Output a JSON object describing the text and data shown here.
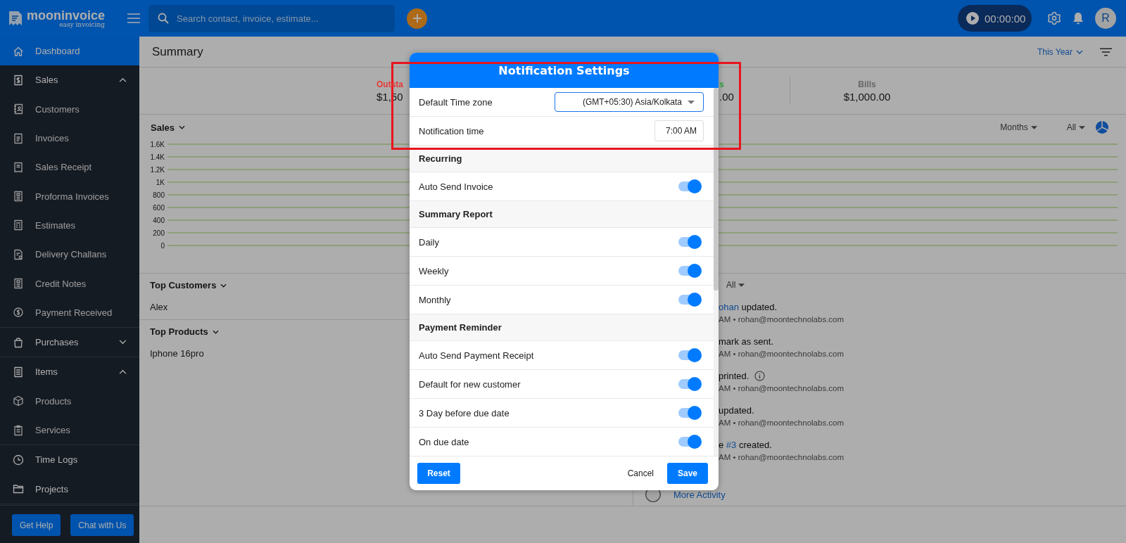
{
  "topbar": {
    "logo_name": "mooninvoice",
    "logo_tagline": "easy invoicing",
    "search": {
      "placeholder": "Search contact, invoice, estimate..."
    },
    "timer": "00:00:00",
    "avatar": "R"
  },
  "sidebar": {
    "items": [
      {
        "label": "Dashboard",
        "selected": true
      },
      {
        "label": "Sales",
        "selected": false,
        "expanded": true,
        "children": [
          {
            "label": "Customers",
            "selected": false
          },
          {
            "label": "Invoices",
            "selected": false
          },
          {
            "label": "Sales Receipt",
            "selected": false
          },
          {
            "label": "Proforma Invoices",
            "selected": false
          },
          {
            "label": "Estimates",
            "selected": false
          },
          {
            "label": "Delivery Challans",
            "selected": false
          },
          {
            "label": "Credit Notes",
            "selected": false
          },
          {
            "label": "Payment Received",
            "selected": false
          }
        ]
      },
      {
        "label": "Purchases",
        "selected": false,
        "expanded": false
      },
      {
        "label": "Items",
        "selected": false,
        "expanded": true,
        "children": [
          {
            "label": "Products",
            "selected": false
          },
          {
            "label": "Services",
            "selected": false
          }
        ]
      },
      {
        "label": "Time Logs",
        "selected": false
      },
      {
        "label": "Projects",
        "selected": false
      }
    ],
    "buttons": [
      "Get Help",
      "Chat with Us"
    ]
  },
  "main": {
    "title": "Summary",
    "period": "This Year",
    "stats": [
      {
        "label": "Outsta",
        "amount": "$1,50",
        "color": "#e53935"
      },
      {
        "label": "s",
        "amount": ".00",
        "color": "#2e9d3c"
      },
      {
        "label": "Bills",
        "amount": "$1,000.00",
        "color": "#666666"
      }
    ],
    "sales": {
      "title": "Sales",
      "grouping": "Months",
      "filter": "All",
      "axis_labels": [
        "1.6K",
        "1.4K",
        "1.2K",
        "1K",
        "800",
        "600",
        "400",
        "200",
        "0"
      ]
    },
    "top_customers": {
      "title": "Top Customers",
      "rows": [
        "Alex"
      ]
    },
    "top_products": {
      "title": "Top Products",
      "rows": [
        "Iphone 16pro"
      ]
    },
    "activity": {
      "filter": "All",
      "entries": [
        {
          "segments": [
            {
              "kind": "link",
              "text": "ohan"
            },
            {
              "kind": "text",
              "text": " updated."
            }
          ],
          "meta": "AM • rohan@moontechnolabs.com",
          "info": false
        },
        {
          "segments": [
            {
              "kind": "text",
              "text": "mark as sent."
            }
          ],
          "meta": "AM • rohan@moontechnolabs.com",
          "info": false
        },
        {
          "segments": [
            {
              "kind": "text",
              "text": "printed."
            }
          ],
          "meta": "AM • rohan@moontechnolabs.com",
          "info": true
        },
        {
          "segments": [
            {
              "kind": "text",
              "text": "updated."
            }
          ],
          "meta": "AM • rohan@moontechnolabs.com",
          "info": false
        },
        {
          "segments": [
            {
              "kind": "text",
              "text": "e "
            },
            {
              "kind": "link",
              "text": "#3"
            },
            {
              "kind": "text",
              "text": " created."
            }
          ],
          "meta": "AM • rohan@moontechnolabs.com",
          "info": false
        }
      ],
      "more": "More Activity"
    }
  },
  "dialog": {
    "title": "Notification Settings",
    "rows": [
      {
        "kind": "select",
        "label": "Default Time zone",
        "value": "(GMT+05:30) Asia/Kolkata"
      },
      {
        "kind": "time",
        "label": "Notification time",
        "value": "7:00 AM"
      },
      {
        "kind": "section",
        "label": "Recurring"
      },
      {
        "kind": "toggle",
        "label": "Auto Send Invoice",
        "on": true
      },
      {
        "kind": "section",
        "label": "Summary Report"
      },
      {
        "kind": "toggle",
        "label": "Daily",
        "on": true
      },
      {
        "kind": "toggle",
        "label": "Weekly",
        "on": true
      },
      {
        "kind": "toggle",
        "label": "Monthly",
        "on": true
      },
      {
        "kind": "section",
        "label": "Payment Reminder"
      },
      {
        "kind": "toggle",
        "label": "Auto Send Payment Receipt",
        "on": true
      },
      {
        "kind": "toggle",
        "label": "Default for new customer",
        "on": true
      },
      {
        "kind": "toggle",
        "label": "3 Day before due date",
        "on": true
      },
      {
        "kind": "toggle",
        "label": "On due date",
        "on": true
      }
    ],
    "buttons": {
      "reset": "Reset",
      "cancel": "Cancel",
      "save": "Save"
    }
  }
}
